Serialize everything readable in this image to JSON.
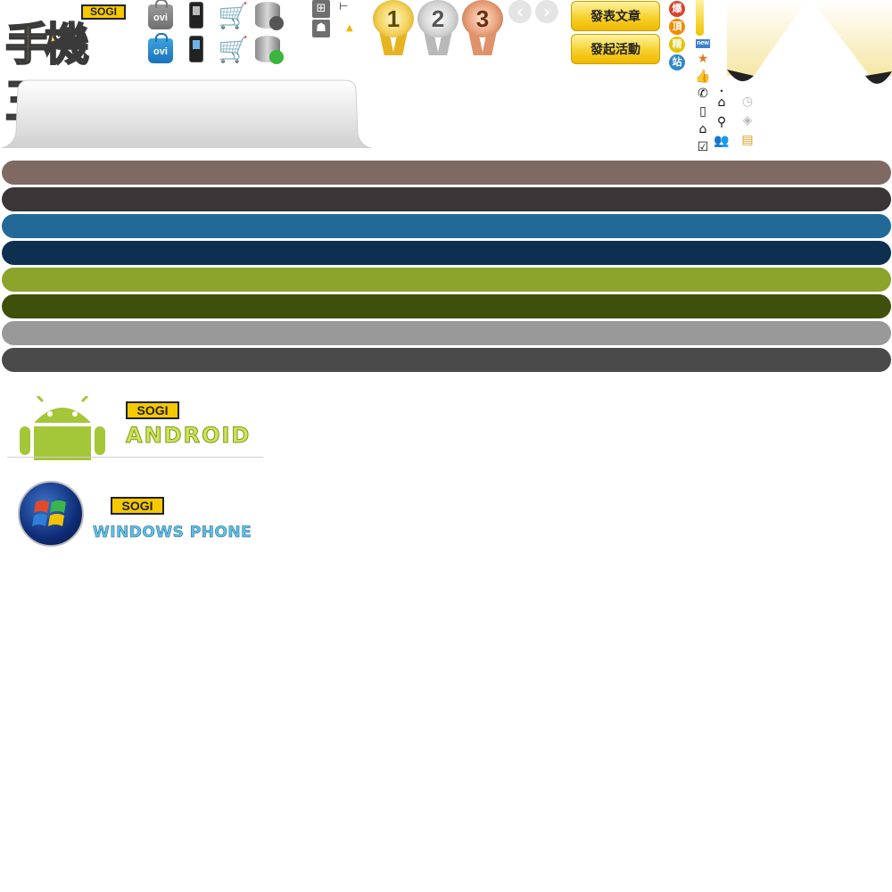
{
  "logo": {
    "badge": "SOGI",
    "title": "手機王"
  },
  "ovi": {
    "label_1": "ovi",
    "label_2": "ovi"
  },
  "medals": {
    "first": "1",
    "second": "2",
    "third": "3"
  },
  "arrows": {
    "prev": "‹",
    "next": "›"
  },
  "buttons": {
    "post_article": "發表文章",
    "start_event": "發起活動"
  },
  "badges": {
    "hot": "爆",
    "top": "頂",
    "best": "精",
    "site": "站"
  },
  "small_icons": {
    "new": "new"
  },
  "android_block": {
    "sogi": "SOGI",
    "word": "ANDROID"
  },
  "windows_block": {
    "sogi": "SOGI",
    "word": "WINDOWS PHONE"
  },
  "bar_colors": [
    "#7e6a63",
    "#3a3536",
    "#226998",
    "#0e3050",
    "#8aa42c",
    "#3f500a",
    "#999999",
    "#4a4a4a"
  ],
  "icons": [
    "ovi-bag-icon",
    "mobile-phone-icon",
    "shopping-cart-icon",
    "database-icon",
    "windows-icon",
    "android-icon",
    "tree-icon",
    "warning-icon",
    "star-icon",
    "thumb-up-icon",
    "phone-icon",
    "home-icon",
    "map-pin-icon",
    "check-icon",
    "users-icon",
    "clock-icon",
    "tag-icon",
    "note-icon"
  ]
}
